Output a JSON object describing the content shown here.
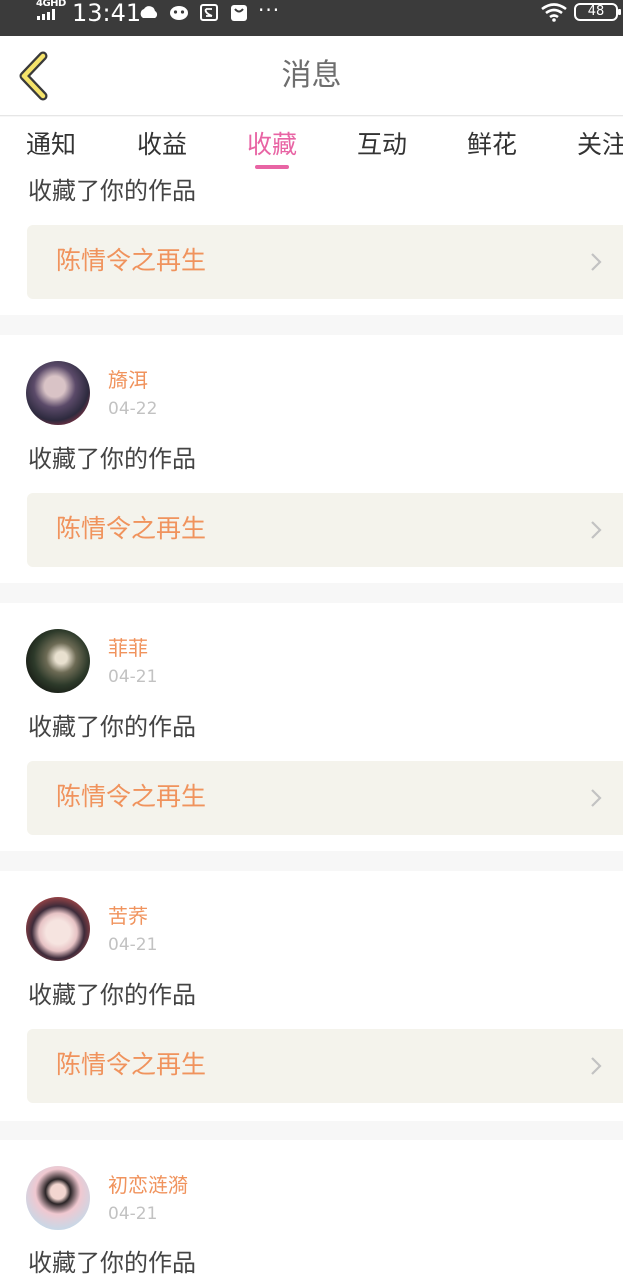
{
  "status_bar": {
    "network": "4GHD",
    "time": "13:41",
    "battery": "48",
    "dots": "···"
  },
  "header": {
    "title": "消息"
  },
  "tabs": [
    {
      "label": "通知"
    },
    {
      "label": "收益"
    },
    {
      "label": "收藏",
      "active": true
    },
    {
      "label": "互动"
    },
    {
      "label": "鲜花"
    },
    {
      "label": "关注"
    }
  ],
  "colors": {
    "accent": "#e864a4",
    "name_orange": "#f0935d",
    "work_box_bg": "#f4f3ec"
  },
  "messages": [
    {
      "text": "收藏了你的作品",
      "work": "陈情令之再生"
    },
    {
      "name": "旖洱",
      "date": "04-22",
      "text": "收藏了你的作品",
      "work": "陈情令之再生"
    },
    {
      "name": "菲菲",
      "date": "04-21",
      "text": "收藏了你的作品",
      "work": "陈情令之再生"
    },
    {
      "name": "苦荞",
      "date": "04-21",
      "text": "收藏了你的作品",
      "work": "陈情令之再生"
    },
    {
      "name": "初恋涟漪",
      "date": "04-21",
      "text": "收藏了你的作品"
    }
  ]
}
